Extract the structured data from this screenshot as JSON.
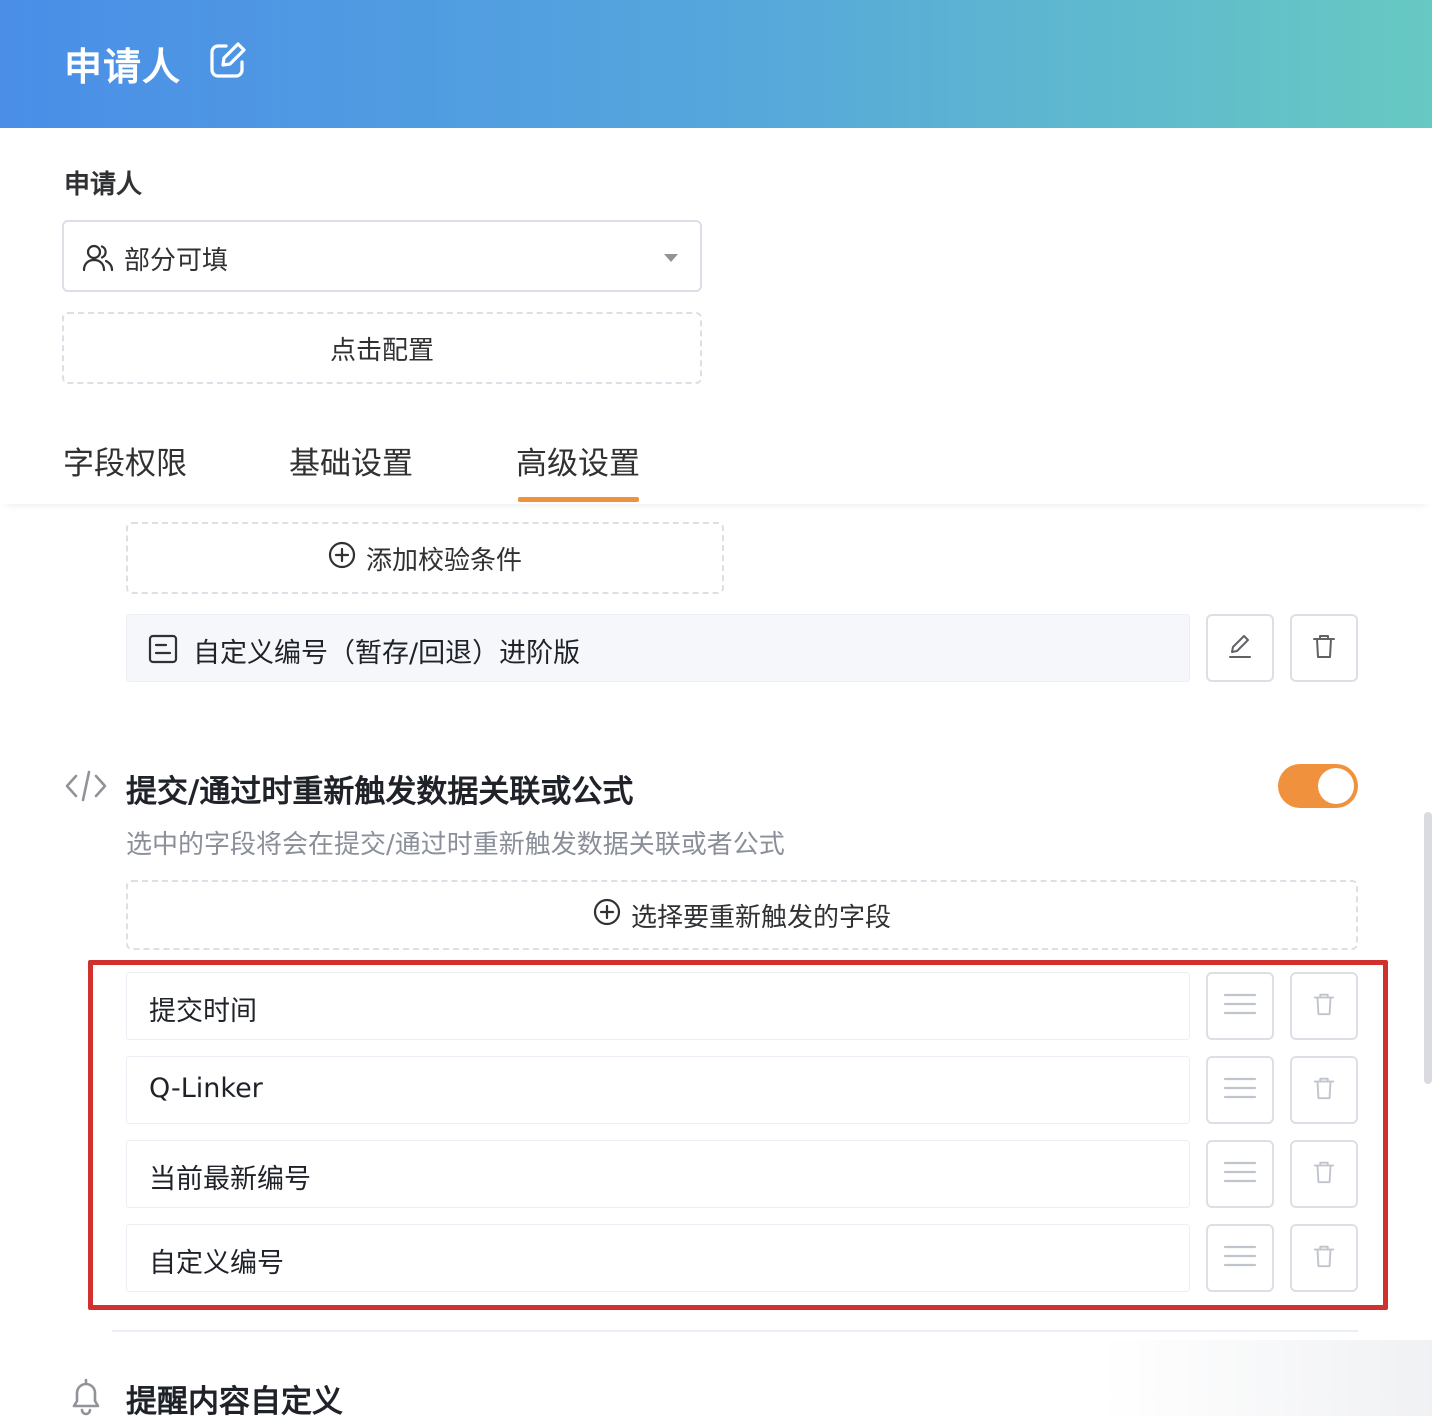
{
  "header": {
    "title": "申请人"
  },
  "field": {
    "label": "申请人"
  },
  "permission_select": {
    "value": "部分可填"
  },
  "config_button": {
    "label": "点击配置"
  },
  "tabs": [
    {
      "label": "字段权限"
    },
    {
      "label": "基础设置"
    },
    {
      "label": "高级设置",
      "active": true
    }
  ],
  "validation": {
    "add_button_label": "添加校验条件",
    "rules": [
      {
        "label": "自定义编号（暂存/回退）进阶版"
      }
    ]
  },
  "retrigger": {
    "title": "提交/通过时重新触发数据关联或公式",
    "description": "选中的字段将会在提交/通过时重新触发数据关联或者公式",
    "enabled": true,
    "select_button_label": "选择要重新触发的字段",
    "fields": [
      {
        "label": "提交时间"
      },
      {
        "label": "Q-Linker"
      },
      {
        "label": "当前最新编号"
      },
      {
        "label": "自定义编号"
      }
    ]
  },
  "reminder": {
    "title": "提醒内容自定义"
  },
  "colors": {
    "header_gradient_start": "#4a8ee8",
    "header_gradient_end": "#67c9c2",
    "accent": "#f0923d",
    "highlight": "#d0312d"
  },
  "icons": {
    "header_edit": "edit-square-icon",
    "select_user": "users-icon",
    "select_caret": "caret-down-icon",
    "add": "plus-circle-icon",
    "rule": "document-icon",
    "edit": "pencil-icon",
    "delete": "trash-icon",
    "code": "code-icon",
    "drag": "drag-handle-icon",
    "reminder": "bell-icon"
  }
}
